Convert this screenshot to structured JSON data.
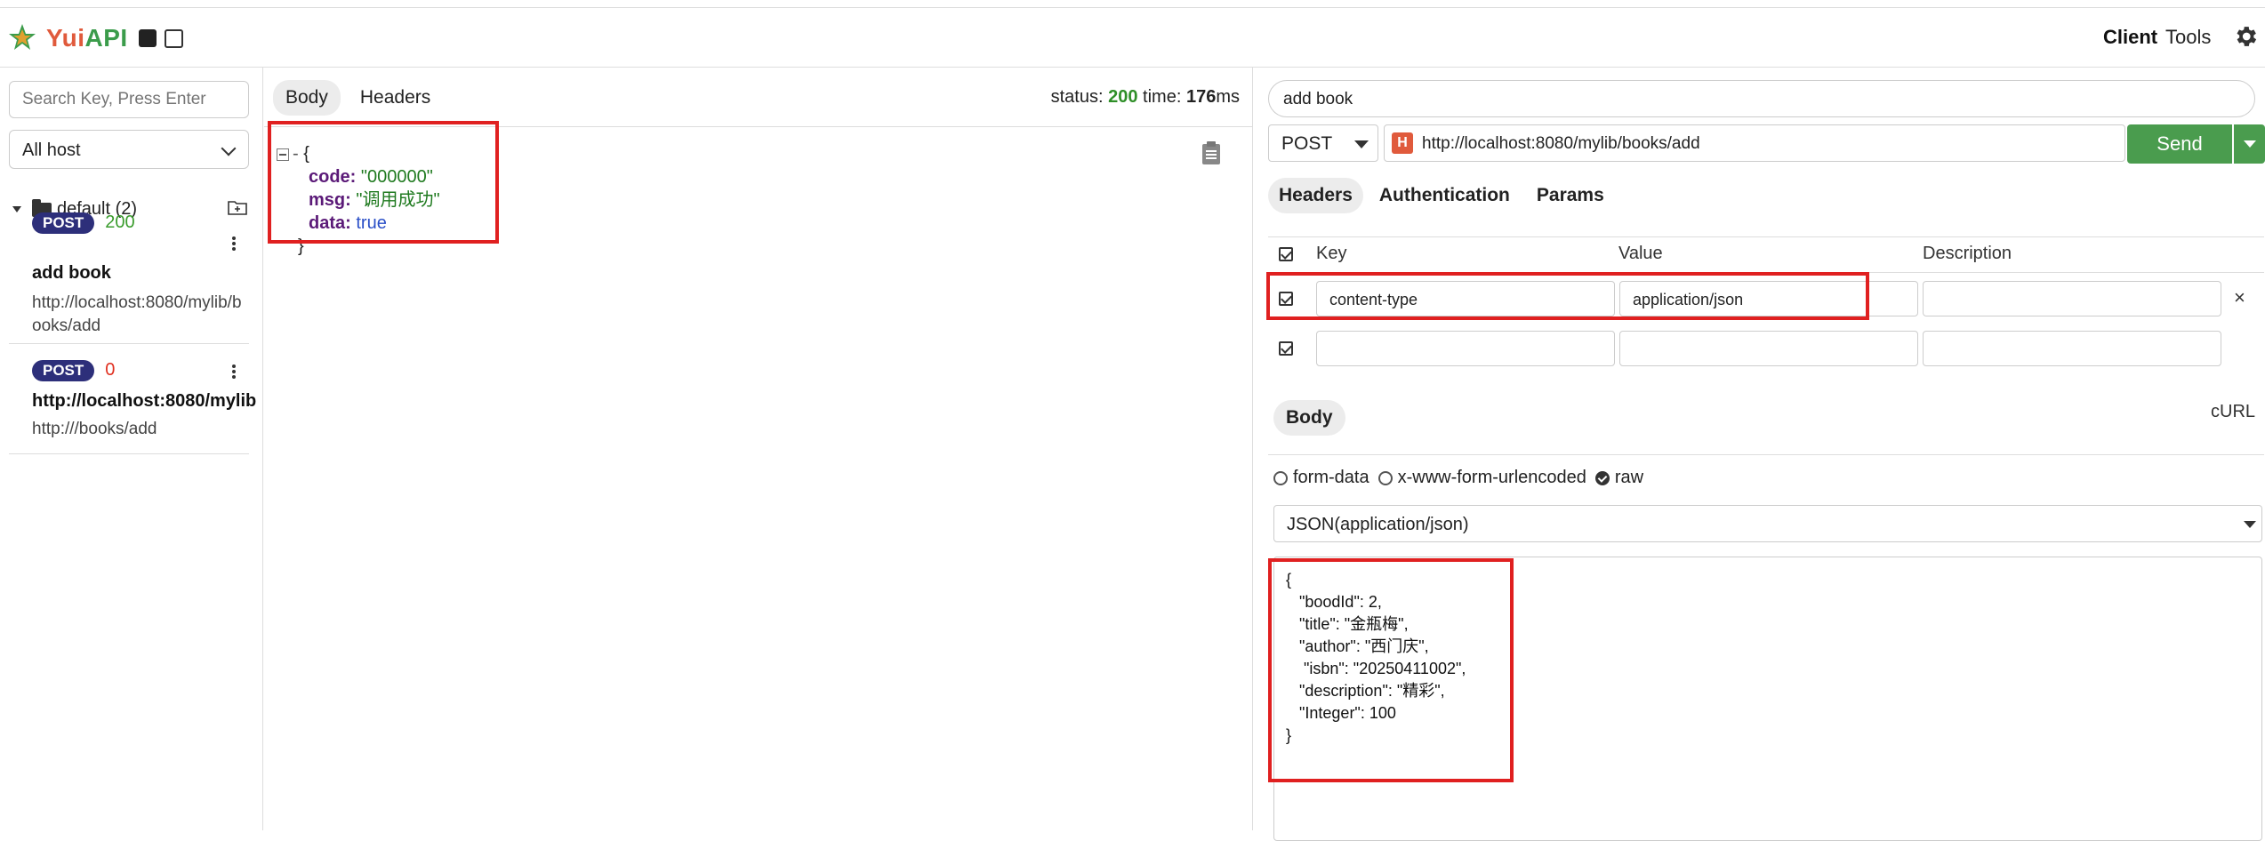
{
  "app": {
    "brand_part1": "Yui",
    "brand_part2": "API"
  },
  "topnav": {
    "client": "Client",
    "tools": "Tools"
  },
  "sidebar": {
    "search_placeholder": "Search Key, Press Enter",
    "host": "All host",
    "folder": "default (2)",
    "items": [
      {
        "method": "POST",
        "code": "200",
        "title": "add book",
        "url_line1": "http://localhost:8080/mylib/b",
        "url_line2": "ooks/add"
      },
      {
        "method": "POST",
        "code": "0",
        "title": "http://localhost:8080/mylib",
        "url_line1": "http:///books/add",
        "url_line2": ""
      }
    ]
  },
  "response": {
    "tabs": [
      "Body",
      "Headers"
    ],
    "status_label": "status:",
    "status_value": "200",
    "time_label": "time:",
    "time_value": "176",
    "time_unit": "ms",
    "json": {
      "open": "{",
      "close": "}",
      "rows": [
        {
          "key": "code:",
          "value": "\"000000\""
        },
        {
          "key": "msg:",
          "value": "\"调用成功\""
        },
        {
          "key": "data:",
          "value": "true"
        }
      ]
    }
  },
  "request": {
    "name": "add book",
    "method": "POST",
    "url": "http://localhost:8080/mylib/books/add",
    "url_icon": "H",
    "send": "Send",
    "tabs": [
      "Headers",
      "Authentication",
      "Params"
    ],
    "header_cols": {
      "key": "Key",
      "value": "Value",
      "description": "Description"
    },
    "headers": [
      {
        "key": "content-type",
        "value": "application/json",
        "description": ""
      },
      {
        "key": "",
        "value": "",
        "description": ""
      }
    ],
    "remove_symbol": "×",
    "body_tab": "Body",
    "curl": "cURL",
    "body_types": [
      "form-data",
      "x-www-form-urlencoded",
      "raw"
    ],
    "content_type": "JSON(application/json)",
    "body_code": "{\n   \"boodId\": 2,\n   \"title\": \"金瓶梅\",\n   \"author\": \"西门庆\",\n    \"isbn\": \"20250411002\",\n   \"description\": \"精彩\",\n   \"Integer\": 100\n}"
  },
  "colors": {
    "accent_green": "#4a9c4e",
    "badge_blue": "#2d2f7a",
    "highlight_red": "#e02020"
  }
}
